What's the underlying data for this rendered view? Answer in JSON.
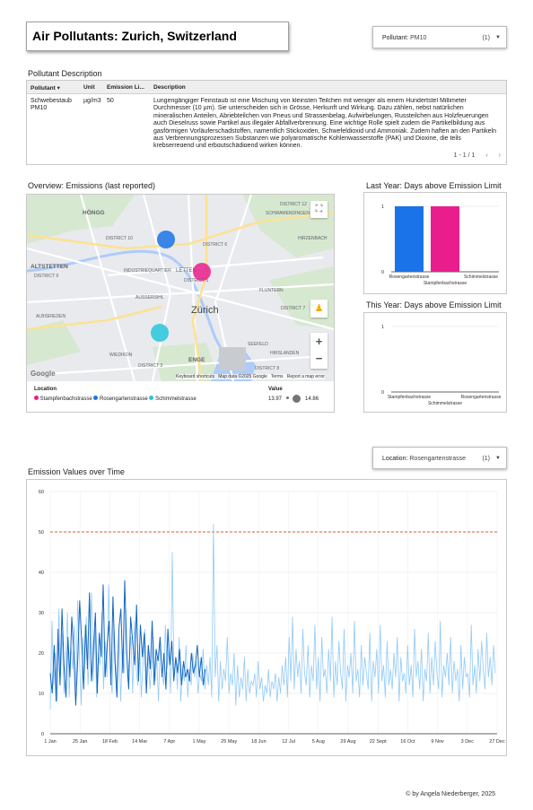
{
  "title": "Air Pollutants: Zurich, Switzerland",
  "pollutant_dropdown": {
    "label": "Pollutant:",
    "value": "PM10",
    "count": "(1)"
  },
  "description_section": {
    "title": "Pollutant Description",
    "columns": [
      "Pollutant",
      "Unit",
      "Emission Li...",
      "Description"
    ],
    "row": {
      "pollutant": "Schwebestaub PM10",
      "unit": "µg/m3",
      "limit": "50",
      "description": "Lungengängiger Feinstaub ist eine Mischung von kleinsten Teilchen mit weniger als einem Hundertstel Millimeter Durchmesser (10 µm). Sie unterscheiden sich in Grösse, Herkunft und Wirkung. Dazu zählen, nebst natürlichen mineralischen Anteilen, Abriebteilchen von Pneus und Strassenbelag, Aufwirbelungen, Russteilchen aus Holzfeuerungen auch Dieselruss sowie Partikel aus illegaler Abfallverbrennung. Eine wichtige Rolle spielt zudem die Partikelbildung aus gasförmigen Vorläuferschadstoffen, namentlich Stickoxiden, Schwefeldioxid und Ammoniak. Zudem haften an den Partikeln aus Verbrennungsprozessen Substanzen wie polyaromatische Kohlenwasserstoffe (PAK) und Dioxine, die teils krebserregend und erbgutschädigend wirken können."
    },
    "pager": "1 - 1 / 1"
  },
  "map_section": {
    "title": "Overview: Emissions (last reported)",
    "labels": {
      "hongg": "HÖNGG",
      "altstetten": "ALTSTETTEN",
      "district9": "DISTRICT 9",
      "industriequartier": "INDUSTRIEQUARTIER",
      "letten": "LETTEN",
      "district5": "DISTRICT 5",
      "district6": "DISTRICT 6",
      "district10": "DISTRICT 10",
      "district12": "DISTRICT 12",
      "schwamendingen": "SCHWAMENDINGEN MITTE",
      "hirzenbach": "HIRZENBACH",
      "fluntern": "FLUNTERN",
      "district7": "DISTRICT 7",
      "zurich": "Zürich",
      "aussersihl": "AUSSERSIHL",
      "albisrieden": "ALBISRIEDEN",
      "enge": "ENGE",
      "wiedikon": "WIEDIKON",
      "district3": "DISTRICT 3",
      "hirslanden": "HIRSLANDEN",
      "district8": "DISTRICT 8",
      "seefeld": "SEEFELD"
    },
    "attribution": {
      "google": "Google",
      "shortcuts": "Keyboard shortcuts",
      "mapdata": "Map data ©2025 Google",
      "terms": "Terms",
      "report": "Report a map error"
    },
    "legend_title": "Location",
    "value_title": "Value",
    "value_min": "13.97",
    "value_max": "14.86",
    "locations": [
      {
        "name": "Stampfenbachstrasse",
        "color": "#e91e8c"
      },
      {
        "name": "Rosengartenstrasse",
        "color": "#1a73e8"
      },
      {
        "name": "Schimmelstrasse",
        "color": "#26c6da"
      }
    ]
  },
  "last_year": {
    "title": "Last Year: Days above Emission Limit",
    "chart_data": {
      "type": "bar",
      "categories": [
        "Rosengartenstrasse",
        "Stampfenbachstrasse",
        "Schimmelstrasse"
      ],
      "values": [
        1,
        1,
        0
      ],
      "colors": [
        "#1a73e8",
        "#e91e8c",
        "#26c6da"
      ],
      "ylim": [
        0,
        1
      ],
      "yticks": [
        "0",
        "1"
      ]
    }
  },
  "this_year": {
    "title": "This Year: Days above Emission Limit",
    "chart_data": {
      "type": "bar",
      "categories": [
        "Stampfenbachstrasse",
        "Schimmelstrasse",
        "Rosengartenstrasse"
      ],
      "values": [
        0,
        0,
        0
      ],
      "ylim": [
        0,
        1
      ],
      "yticks": [
        "0",
        "1"
      ]
    }
  },
  "location_dropdown": {
    "label": "Location:",
    "value": "Rosengartenstrasse",
    "count": "(1)"
  },
  "timeseries": {
    "title": "Emission Values over Time",
    "chart_data": {
      "type": "line",
      "ylim": [
        0,
        60
      ],
      "yticks": [
        0,
        10,
        20,
        30,
        40,
        50,
        60
      ],
      "xticks": [
        "1 Jan",
        "25 Jan",
        "18 Feb",
        "14 Mar",
        "7 Apr",
        "1 May",
        "25 May",
        "18 Jun",
        "12 Jul",
        "5 Aug",
        "29 Aug",
        "22 Sept",
        "16 Oct",
        "9 Nov",
        "3 Dec",
        "27 Dec"
      ],
      "limit_line": 50,
      "series": [
        {
          "color": "#1565c0",
          "values": [
            15,
            10,
            22,
            8,
            26,
            12,
            31,
            17,
            9,
            24,
            14,
            29,
            20,
            7,
            18,
            33,
            23,
            11,
            27,
            16,
            35,
            13,
            21,
            30,
            10,
            25,
            19,
            37,
            14,
            22,
            28,
            12,
            34,
            18,
            9,
            26,
            31,
            15,
            38,
            20,
            11,
            29,
            23,
            17,
            32,
            13,
            27,
            19,
            25,
            10,
            22,
            16,
            28,
            12,
            21,
            18,
            24,
            14,
            20,
            11,
            26,
            17,
            23,
            13,
            19,
            15,
            21,
            12,
            18,
            14,
            16,
            13,
            20,
            15,
            17,
            22,
            14,
            19,
            12,
            16
          ]
        },
        {
          "color": "#90caf9",
          "values": [
            6,
            28,
            12,
            20,
            8,
            31,
            14,
            25,
            10,
            18,
            30,
            9,
            22,
            16,
            27,
            11,
            33,
            19,
            7,
            24,
            15,
            29,
            12,
            21,
            35,
            13,
            26,
            9,
            20,
            17,
            30,
            11,
            23,
            14,
            37,
            16,
            10,
            27,
            18,
            12,
            25,
            8,
            21,
            15,
            31,
            13,
            19,
            24,
            10,
            28,
            16,
            12,
            22,
            9,
            18,
            26,
            14,
            20,
            11,
            17,
            24,
            13,
            19,
            8,
            23,
            15,
            12,
            27,
            16,
            21,
            10,
            45,
            14,
            19,
            11,
            24,
            8,
            17,
            13,
            22,
            9,
            16,
            12,
            20,
            14,
            18,
            10,
            15,
            13,
            21,
            11,
            17,
            12,
            19,
            9,
            52,
            14,
            22,
            8,
            18,
            11,
            16,
            13,
            24,
            10,
            15,
            12,
            20,
            7,
            17,
            9,
            14,
            11,
            19,
            8,
            16,
            10,
            13,
            12,
            15,
            9,
            18,
            11,
            14,
            8,
            12,
            10,
            16,
            9,
            13,
            11,
            15,
            8,
            14,
            10,
            17,
            12,
            19,
            9,
            24,
            13,
            29,
            11,
            21,
            14,
            18,
            10,
            26,
            15,
            12,
            22,
            9,
            17,
            13,
            27,
            11,
            19,
            8,
            24,
            14,
            16,
            10,
            21,
            13,
            29,
            9,
            18,
            12,
            23,
            15,
            11,
            26,
            8,
            17,
            14,
            20,
            10,
            28,
            13,
            16,
            9,
            22,
            12,
            19,
            15,
            11,
            25,
            8,
            18,
            14,
            21,
            10,
            27,
            13,
            17,
            9,
            23,
            12,
            16,
            11,
            20,
            14,
            24,
            8,
            19,
            13,
            15,
            10,
            22,
            12,
            17,
            9,
            26,
            14,
            18,
            11,
            21,
            8,
            16,
            13,
            25,
            10,
            19,
            12,
            23,
            15,
            11,
            28,
            9,
            17,
            14,
            20,
            12,
            24,
            10,
            18,
            13,
            16,
            8,
            22,
            11,
            19,
            14,
            15,
            9,
            27,
            12,
            17,
            10,
            21,
            13,
            23,
            16,
            11,
            25,
            14,
            19,
            12,
            22,
            15
          ]
        }
      ]
    }
  },
  "footer": "© by Angela Niederberger, 2025"
}
